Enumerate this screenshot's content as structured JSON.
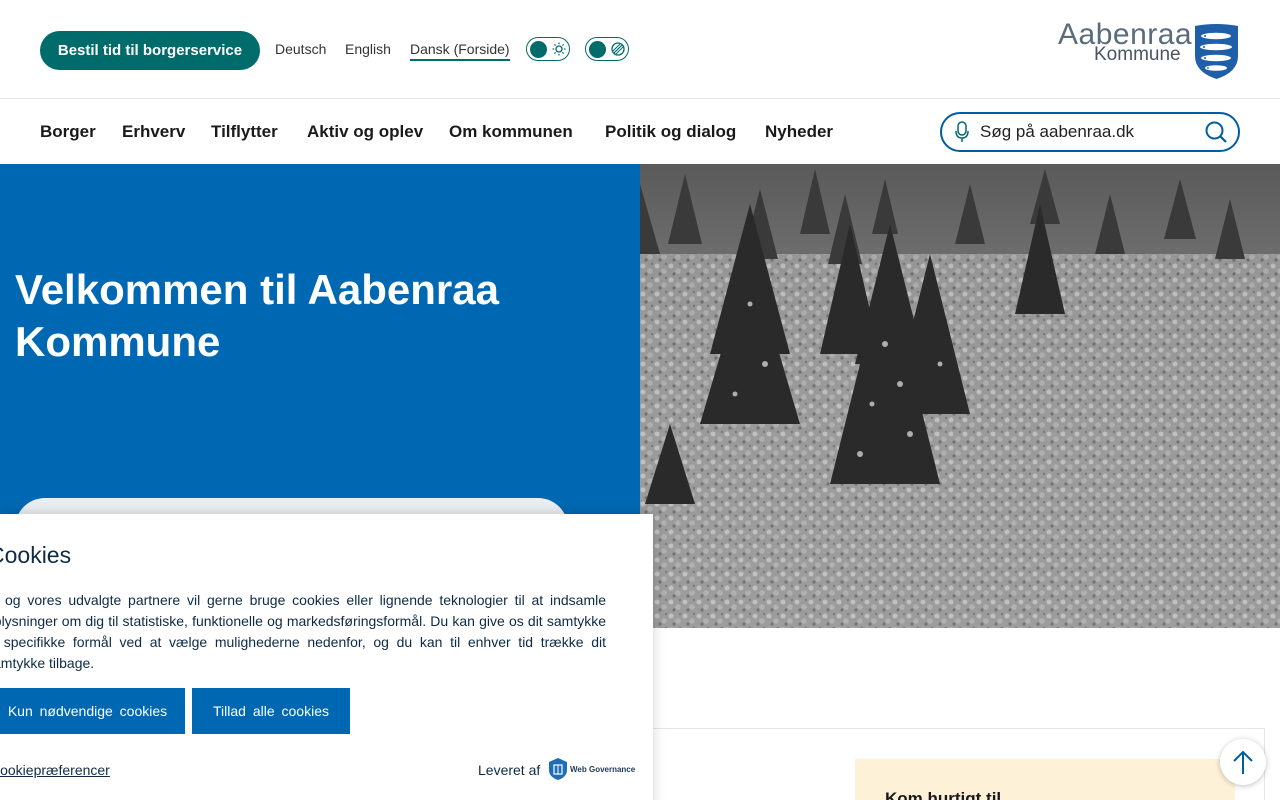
{
  "header": {
    "book_button": "Bestil tid til borgerservice",
    "languages": [
      {
        "label": "Deutsch"
      },
      {
        "label": "English"
      },
      {
        "label": "Dansk (Forside)",
        "active": true
      }
    ],
    "toggles": [
      {
        "icon": "sun-icon"
      },
      {
        "icon": "contrast-icon"
      }
    ],
    "logo": {
      "line1": "Aabenraa",
      "line2": "Kommune"
    }
  },
  "nav": {
    "items": [
      "Borger",
      "Erhverv",
      "Tilflytter",
      "Aktiv og oplev",
      "Om kommunen",
      "Politik og dialog",
      "Nyheder"
    ],
    "search_placeholder": "Søg på aabenraa.dk"
  },
  "hero": {
    "title": "Velkommen til Aabenraa Kommune"
  },
  "quick": {
    "title": "Kom hurtigt til"
  },
  "cookie": {
    "title": "Cookies",
    "body": "Vi og vores udvalgte partnere vil gerne bruge cookies eller lignende teknologier til at indsamle oplysninger om dig til statistiske, funktionelle og markedsføringsformål. Du kan give os dit samtykke til specifikke formål ved at vælge mulighederne nedenfor, og du kan til enhver tid trække dit samtykke tilbage.",
    "btn_necessary": "Kun nødvendige cookies",
    "btn_all": "Tillad alle cookies",
    "prefs_link": "Cookiepræferencer",
    "delivered_by": "Leveret af",
    "provider": "Web Governance"
  },
  "colors": {
    "teal": "#006b6b",
    "blue": "#0068b3",
    "navy": "#005e9e"
  }
}
